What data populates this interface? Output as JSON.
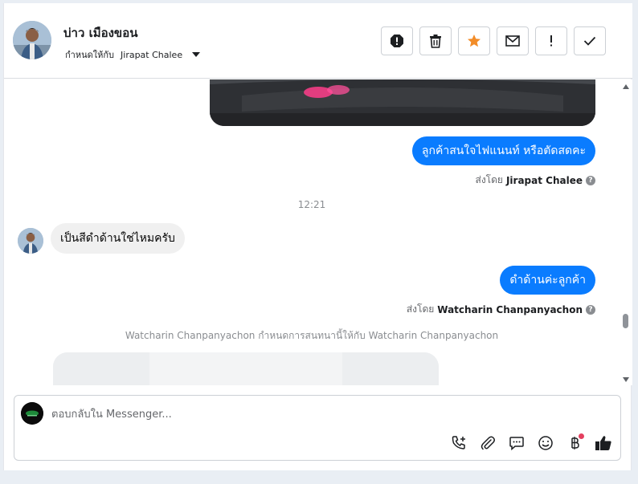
{
  "header": {
    "contact_name": "บ่าว เมืองขอน",
    "assigned_label": "กำหนดให้กับ",
    "assigned_to": "Jirapat Chalee",
    "actions": {
      "spam": "spam-icon",
      "delete": "trash-icon",
      "star": "star-icon",
      "mark_unread": "envelope-icon",
      "follow_up": "exclamation-icon",
      "done": "check-icon"
    },
    "star_color": "#f28c28"
  },
  "messages": {
    "out1_text": "ลูกค้าสนใจไฟแนนท์ หรือตัดสดคะ",
    "out1_sent_by_label": "ส่งโดย",
    "out1_sent_by_name": "Jirapat Chalee",
    "timestamp": "12:21",
    "in1_text": "เป็นสีดำด้านใช่ไหมครับ",
    "out2_text": "ดำด้านค่ะลูกค้า",
    "out2_sent_by_label": "ส่งโดย",
    "out2_sent_by_name": "Watcharin Chanpanyachon",
    "help_glyph": "?",
    "system_note": "Watcharin Chanpanyachon กำหนดการสนทนานี้ให้กับ Watcharin Chanpanyachon"
  },
  "composer": {
    "placeholder": "ตอบกลับใน Messenger...",
    "tools": [
      "phone-plus-icon",
      "paperclip-icon",
      "saved-reply-icon",
      "emoji-icon",
      "baht-payment-icon",
      "thumbs-up-icon"
    ]
  },
  "colors": {
    "outgoing_bubble": "#0a7cff",
    "incoming_bubble": "#f0f0f0",
    "notification_dot": "#e4405f"
  }
}
